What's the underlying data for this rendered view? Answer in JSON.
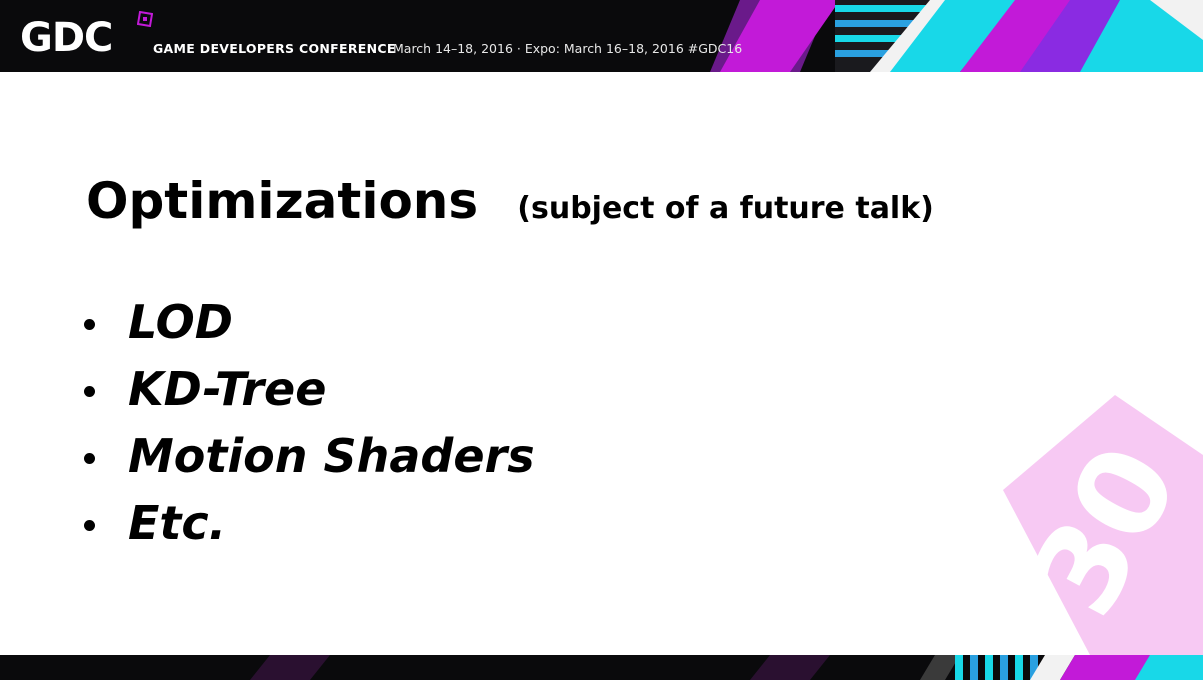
{
  "header": {
    "logo_text": "GDC",
    "conference_name": "GAME DEVELOPERS CONFERENCE",
    "dates_text": "March 14–18, 2016 · Expo: March 16–18, 2016  #GDC16"
  },
  "slide": {
    "title": "Optimizations",
    "subtitle": "(subject of a future talk)",
    "bullets": [
      "LOD",
      "KD-Tree",
      "Motion Shaders",
      "Etc."
    ]
  },
  "watermark": {
    "text": "30"
  },
  "colors": {
    "magenta": "#c21ad8",
    "cyan": "#18d8e8",
    "dark": "#0a0a0c",
    "watermark_pink": "#f7c9f3"
  }
}
